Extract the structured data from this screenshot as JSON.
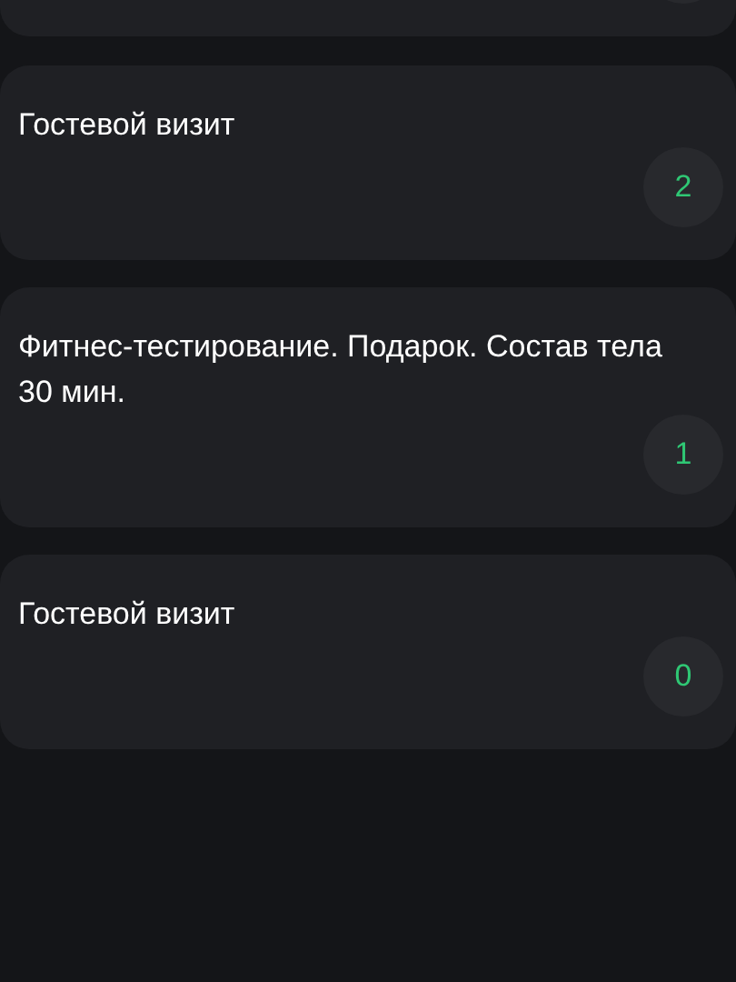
{
  "items": [
    {
      "title": "Гостевой визит",
      "count": "2"
    },
    {
      "title": "Фитнес-тестирование. Подарок. Состав тела 30 мин.",
      "count": "1"
    },
    {
      "title": "Гостевой визит",
      "count": "0"
    }
  ]
}
